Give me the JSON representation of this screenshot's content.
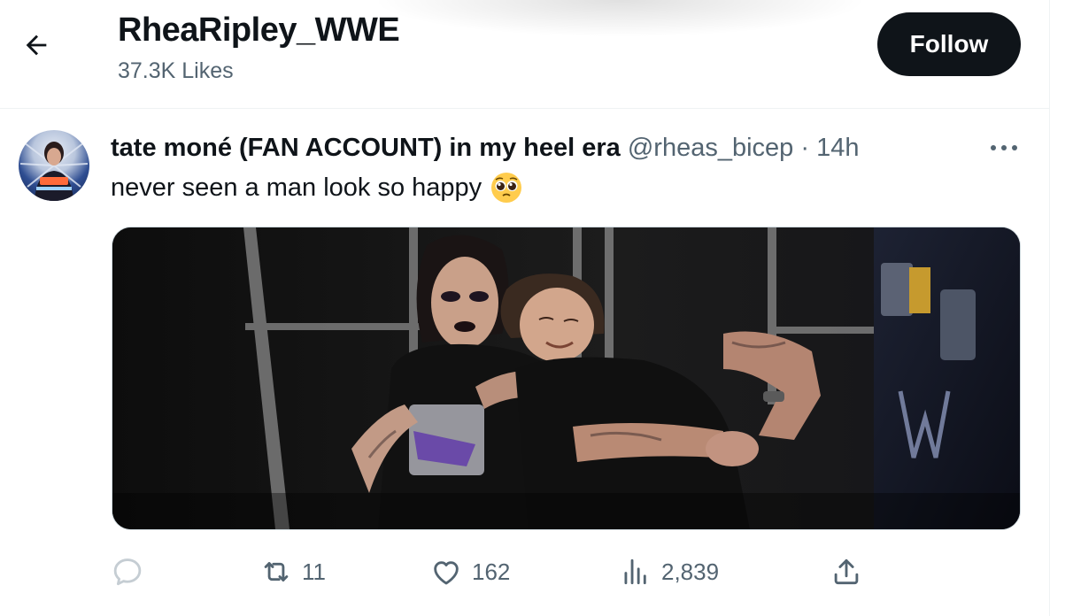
{
  "header": {
    "back_icon": "arrow-left-icon",
    "title": "RheaRipley_WWE",
    "subtitle": "37.3K Likes",
    "follow_label": "Follow"
  },
  "tweet": {
    "author_name": "tate moné (FAN ACCOUNT) in my heel era",
    "handle": "@rheas_bicep",
    "separator": "·",
    "time": "14h",
    "text": "never seen a man look so happy",
    "emoji_icon": "pleading-face-emoji",
    "more_icon": "more-horizontal-icon",
    "media_label": "photo"
  },
  "actions": {
    "reply": {
      "icon": "reply-icon",
      "count": ""
    },
    "retweet": {
      "icon": "retweet-icon",
      "count": "11"
    },
    "like": {
      "icon": "heart-icon",
      "count": "162"
    },
    "views": {
      "icon": "views-icon",
      "count": "2,839"
    },
    "share": {
      "icon": "share-icon"
    }
  },
  "colors": {
    "text_primary": "#0f1419",
    "text_secondary": "#536471",
    "action_icon": "#536471",
    "border": "#eff3f4",
    "follow_bg": "#0f1419"
  }
}
